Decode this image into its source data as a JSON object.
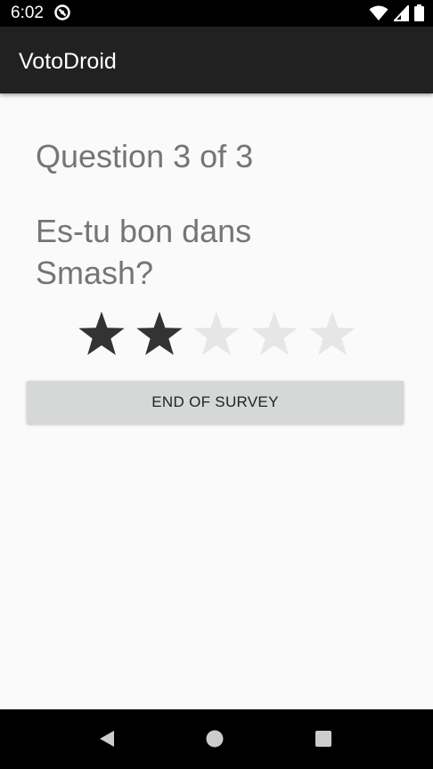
{
  "status_bar": {
    "time": "6:02",
    "icons": [
      "app-notification-icon",
      "wifi-icon",
      "cell-signal-icon",
      "battery-icon"
    ]
  },
  "app_bar": {
    "title": "VotoDroid"
  },
  "survey": {
    "progress": "Question 3 of 3",
    "question": "Es-tu bon dans Smash?",
    "rating": {
      "value": 2,
      "max": 5
    },
    "end_button_label": "END OF SURVEY"
  },
  "nav_bar": {
    "buttons": [
      "back-icon",
      "home-icon",
      "recents-icon"
    ]
  },
  "colors": {
    "app_bar": "#212121",
    "status_bar": "#000000",
    "background": "#fafafa",
    "text_secondary": "#757575",
    "star_filled": "#333333",
    "star_empty": "#e6e6e6",
    "button": "#d6d7d7"
  }
}
